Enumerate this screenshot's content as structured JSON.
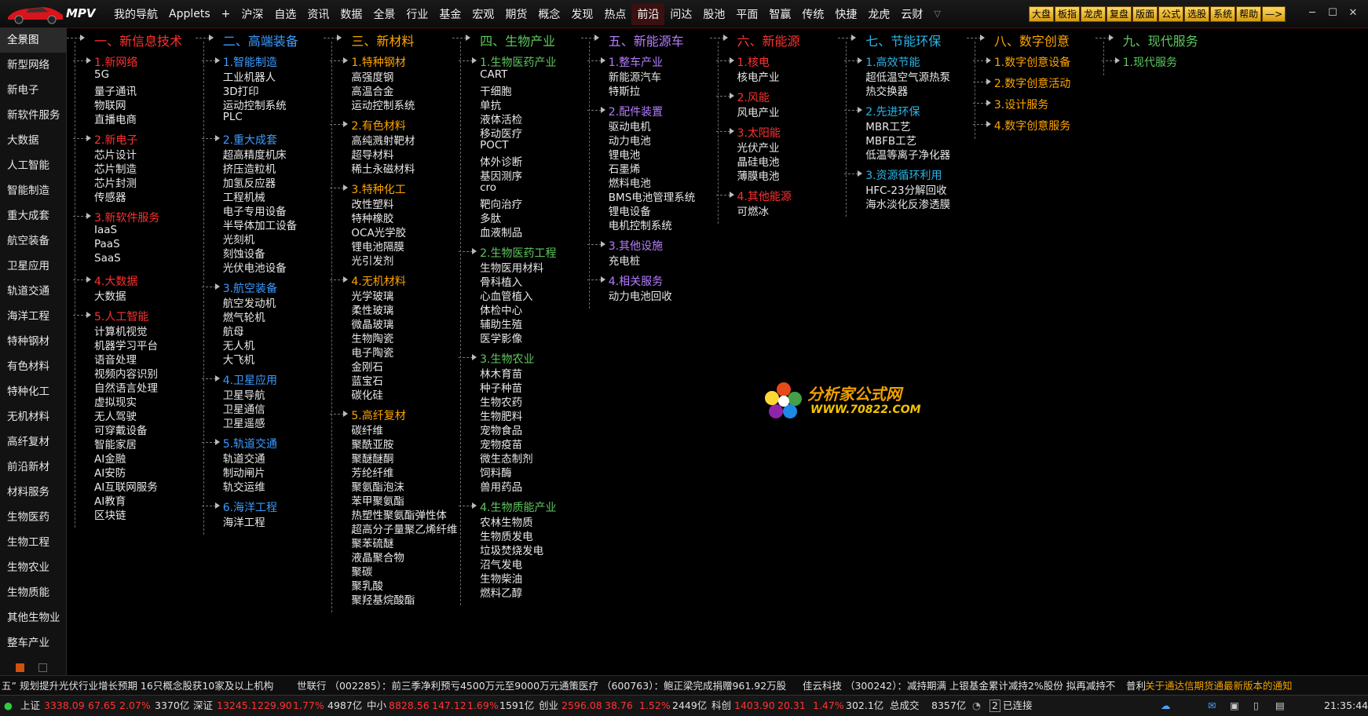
{
  "app": {
    "logo": "MPV"
  },
  "menu": [
    {
      "label": "我的导航"
    },
    {
      "label": "Applets"
    },
    {
      "label": "+"
    },
    {
      "label": "沪深"
    },
    {
      "label": "自选"
    },
    {
      "label": "资讯"
    },
    {
      "label": "数据"
    },
    {
      "label": "全景"
    },
    {
      "label": "行业"
    },
    {
      "label": "基金"
    },
    {
      "label": "宏观"
    },
    {
      "label": "期货"
    },
    {
      "label": "概念"
    },
    {
      "label": "发现"
    },
    {
      "label": "热点"
    },
    {
      "label": "前沿",
      "active": true
    },
    {
      "label": "问达"
    },
    {
      "label": "股池"
    },
    {
      "label": "平面"
    },
    {
      "label": "智赢"
    },
    {
      "label": "传统"
    },
    {
      "label": "快捷"
    },
    {
      "label": "龙虎"
    },
    {
      "label": "云财"
    },
    {
      "label": "▽",
      "more": true
    }
  ],
  "tool_buttons": [
    "大盘",
    "板指",
    "龙虎",
    "复盘",
    "版面",
    "公式",
    "选股",
    "系统",
    "帮助",
    "—>"
  ],
  "sidebar": [
    "全景图",
    "新型网络",
    "新电子",
    "新软件服务",
    "大数据",
    "人工智能",
    "智能制造",
    "重大成套",
    "航空装备",
    "卫星应用",
    "轨道交通",
    "海洋工程",
    "特种钢材",
    "有色材料",
    "特种化工",
    "无机材料",
    "高纤复材",
    "前沿新材",
    "材料服务",
    "生物医药",
    "生物工程",
    "生物农业",
    "生物质能",
    "其他生物业",
    "整车产业"
  ],
  "colors": {
    "red": "#ff3030",
    "blue": "#3d9bff",
    "orange": "#ffa500",
    "green": "#5ec85e",
    "purple": "#b57cff",
    "cyan": "#2ab5e6",
    "lime": "#9acd32",
    "yellow": "#e6c619",
    "teal": "#3cb8a8"
  },
  "tree": [
    {
      "title": "一、新信息技术",
      "color": "red",
      "groups": [
        {
          "label": "1.新网络",
          "color": "red",
          "items": [
            "5G",
            "量子通讯",
            "物联网",
            "直播电商"
          ]
        },
        {
          "label": "2.新电子",
          "color": "red",
          "items": [
            "芯片设计",
            "芯片制造",
            "芯片封测",
            "传感器"
          ]
        },
        {
          "label": "3.新软件服务",
          "color": "red",
          "items": [
            "IaaS",
            "PaaS",
            "SaaS"
          ]
        },
        {
          "label": "4.大数据",
          "color": "red",
          "items": [
            "大数据"
          ]
        },
        {
          "label": "5.人工智能",
          "color": "red",
          "items": [
            "计算机视觉",
            "机器学习平台",
            "语音处理",
            "视频内容识别",
            "自然语言处理",
            "虚拟现实",
            "无人驾驶",
            "可穿戴设备",
            "智能家居",
            "AI金融",
            "AI安防",
            "AI互联网服务",
            "AI教育",
            "区块链"
          ]
        }
      ]
    },
    {
      "title": "二、高端装备",
      "color": "blue",
      "groups": [
        {
          "label": "1.智能制造",
          "color": "blue",
          "items": [
            "工业机器人",
            "3D打印",
            "运动控制系统",
            "PLC"
          ]
        },
        {
          "label": "2.重大成套",
          "color": "blue",
          "items": [
            "超高精度机床",
            "挤压造粒机",
            "加氢反应器",
            "工程机械",
            "电子专用设备",
            "半导体加工设备",
            "光刻机",
            "刻蚀设备",
            "光伏电池设备"
          ]
        },
        {
          "label": "3.航空装备",
          "color": "blue",
          "items": [
            "航空发动机",
            "燃气轮机",
            "航母",
            "无人机",
            "大飞机"
          ]
        },
        {
          "label": "4.卫星应用",
          "color": "blue",
          "items": [
            "卫星导航",
            "卫星通信",
            "卫星遥感"
          ]
        },
        {
          "label": "5.轨道交通",
          "color": "blue",
          "items": [
            "轨道交通",
            "制动闸片",
            "轨交运维"
          ]
        },
        {
          "label": "6.海洋工程",
          "color": "blue",
          "items": [
            "海洋工程"
          ]
        }
      ]
    },
    {
      "title": "三、新材料",
      "color": "orange",
      "groups": [
        {
          "label": "1.特种钢材",
          "color": "orange",
          "items": [
            "高强度钢",
            "高温合金",
            "运动控制系统"
          ]
        },
        {
          "label": "2.有色材料",
          "color": "orange",
          "items": [
            "高纯溅射靶材",
            "超导材料",
            "稀土永磁材料"
          ]
        },
        {
          "label": "3.特种化工",
          "color": "orange",
          "items": [
            "改性塑料",
            "特种橡胶",
            "OCA光学胶",
            "锂电池隔膜",
            "光引发剂"
          ]
        },
        {
          "label": "4.无机材料",
          "color": "orange",
          "items": [
            "光学玻璃",
            "柔性玻璃",
            "微晶玻璃",
            "生物陶瓷",
            "电子陶瓷",
            "金刚石",
            "蓝宝石",
            "碳化硅"
          ]
        },
        {
          "label": "5.高纤复材",
          "color": "orange",
          "items": [
            "碳纤维",
            "聚酰亚胺",
            "聚醚醚酮",
            "芳纶纤维",
            "聚氨酯泡沫",
            "苯甲聚氨酯",
            "热塑性聚氨酯弹性体",
            "超高分子量聚乙烯纤维",
            "聚苯硫醚",
            "液晶聚合物",
            "聚碳",
            "聚乳酸",
            "聚羟基烷酸酯"
          ]
        }
      ]
    },
    {
      "title": "四、生物产业",
      "color": "green",
      "groups": [
        {
          "label": "1.生物医药产业",
          "color": "green",
          "items": [
            "CART",
            "干细胞",
            "单抗",
            "液体活检",
            "移动医疗",
            "POCT",
            "体外诊断",
            "基因测序",
            "cro",
            "靶向治疗",
            "多肽",
            "血液制品"
          ]
        },
        {
          "label": "2.生物医药工程",
          "color": "green",
          "items": [
            "生物医用材料",
            "骨科植入",
            "心血管植入",
            "体检中心",
            "辅助生殖",
            "医学影像"
          ]
        },
        {
          "label": "3.生物农业",
          "color": "green",
          "items": [
            "林木育苗",
            "种子种苗",
            "生物农药",
            "生物肥料",
            "宠物食品",
            "宠物疫苗",
            "微生态制剂",
            "饲料酶",
            "兽用药品"
          ]
        },
        {
          "label": "4.生物质能产业",
          "color": "green",
          "items": [
            "农林生物质",
            "生物质发电",
            "垃圾焚烧发电",
            "沼气发电",
            "生物柴油",
            "燃料乙醇"
          ]
        }
      ]
    },
    {
      "title": "五、新能源车",
      "color": "purple",
      "groups": [
        {
          "label": "1.整车产业",
          "color": "purple",
          "items": [
            "新能源汽车",
            "特斯拉"
          ]
        },
        {
          "label": "2.配件装置",
          "color": "purple",
          "items": [
            "驱动电机",
            "动力电池",
            "锂电池",
            "石墨烯",
            "燃料电池",
            "BMS电池管理系统",
            "锂电设备",
            "电机控制系统"
          ]
        },
        {
          "label": "3.其他设施",
          "color": "purple",
          "items": [
            "充电桩"
          ]
        },
        {
          "label": "4.相关服务",
          "color": "purple",
          "items": [
            "动力电池回收"
          ]
        }
      ]
    },
    {
      "title": "六、新能源",
      "color": "red",
      "groups": [
        {
          "label": "1.核电",
          "color": "red",
          "items": [
            "核电产业"
          ]
        },
        {
          "label": "2.风能",
          "color": "red",
          "items": [
            "风电产业"
          ]
        },
        {
          "label": "3.太阳能",
          "color": "red",
          "items": [
            "光伏产业",
            "晶硅电池",
            "薄膜电池"
          ]
        },
        {
          "label": "4.其他能源",
          "color": "red",
          "items": [
            "可燃冰"
          ]
        }
      ]
    },
    {
      "title": "七、节能环保",
      "color": "cyan",
      "groups": [
        {
          "label": "1.高效节能",
          "color": "cyan",
          "items": [
            "超低温空气源热泵",
            "热交换器"
          ]
        },
        {
          "label": "2.先进环保",
          "color": "cyan",
          "items": [
            "MBR工艺",
            "MBFB工艺",
            "低温等离子净化器"
          ]
        },
        {
          "label": "3.资源循环利用",
          "color": "cyan",
          "items": [
            "HFC-23分解回收",
            "海水淡化反渗透膜"
          ]
        }
      ]
    },
    {
      "title": "八、数字创意",
      "color": "orange",
      "groups": [
        {
          "label": "1.数字创意设备",
          "color": "orange",
          "items": []
        },
        {
          "label": "2.数字创意活动",
          "color": "orange",
          "items": []
        },
        {
          "label": "3.设计服务",
          "color": "orange",
          "items": []
        },
        {
          "label": "4.数字创意服务",
          "color": "orange",
          "items": []
        }
      ]
    },
    {
      "title": "九、现代服务",
      "color": "green",
      "groups": [
        {
          "label": "1.现代服务",
          "color": "green",
          "items": []
        }
      ]
    }
  ],
  "watermark": {
    "line1": "分析家公式网",
    "line2": "WWW.70822.COM"
  },
  "ticker": [
    "五” 规划提升光伏行业增长预期 16只概念股获10家及以上机构",
    "世联行 （002285）：前三季净利预亏4500万元至9000万元",
    "通策医疗 （600763）：鲍正梁完成捐赠961.92万股",
    "佳云科技 （300242）：减持期满 上银基金累计减持2%股份 拟再减持不",
    "普利",
    "关于通达信期货通最新版本的通知"
  ],
  "status": {
    "sh": {
      "name": "上证",
      "price": "3338.09",
      "chg": "67.65",
      "pct": "2.07%",
      "amt": "3370亿"
    },
    "sz": {
      "name": "深证",
      "price": "13245.1",
      "chg": "229.90",
      "pct": "1.77%",
      "amt": "4987亿"
    },
    "zx": {
      "name": "中小",
      "price": "8828.56",
      "chg": "147.12",
      "pct": "1.69%",
      "amt": "1591亿"
    },
    "cy": {
      "name": "创业",
      "price": "2596.08",
      "chg": "38.76",
      "pct": "1.52%",
      "amt": "2449亿"
    },
    "kc": {
      "name": "科创",
      "price": "1403.90",
      "chg": "20.31",
      "pct": "1.47%",
      "amt": "302.1亿"
    },
    "total_label": "总成交",
    "total": "8357亿",
    "conn_count": "2",
    "conn_label": "已连接",
    "time": "21:35:44"
  }
}
